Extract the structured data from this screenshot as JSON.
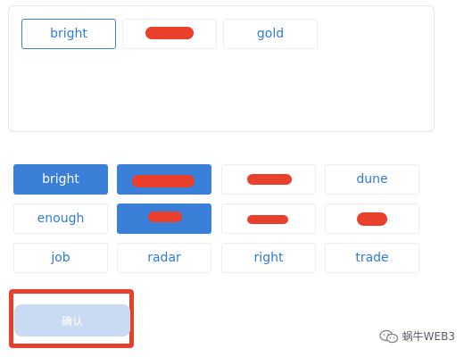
{
  "selected_words": [
    {
      "label": "bright",
      "state": "active"
    },
    {
      "label": "",
      "state": "redacted"
    },
    {
      "label": "gold",
      "state": "normal"
    }
  ],
  "word_bank": [
    {
      "label": "bright",
      "state": "chosen"
    },
    {
      "label": "",
      "state": "chosen-redacted"
    },
    {
      "label": "",
      "state": "redacted"
    },
    {
      "label": "dune",
      "state": "normal"
    },
    {
      "label": "enough",
      "state": "normal"
    },
    {
      "label": "",
      "state": "chosen-redacted"
    },
    {
      "label": "",
      "state": "redacted"
    },
    {
      "label": "",
      "state": "redacted"
    },
    {
      "label": "job",
      "state": "normal"
    },
    {
      "label": "radar",
      "state": "normal"
    },
    {
      "label": "right",
      "state": "normal"
    },
    {
      "label": "trade",
      "state": "normal"
    }
  ],
  "confirm_button": {
    "label": "确认",
    "enabled": false
  },
  "watermark": {
    "text": "蜗牛WEB3",
    "icon": "wechat-icon"
  },
  "colors": {
    "accent": "#3a7fd8",
    "text_blue": "#2f7bd8",
    "redaction": "#e8402a",
    "disabled_button": "#c9dbf3"
  }
}
